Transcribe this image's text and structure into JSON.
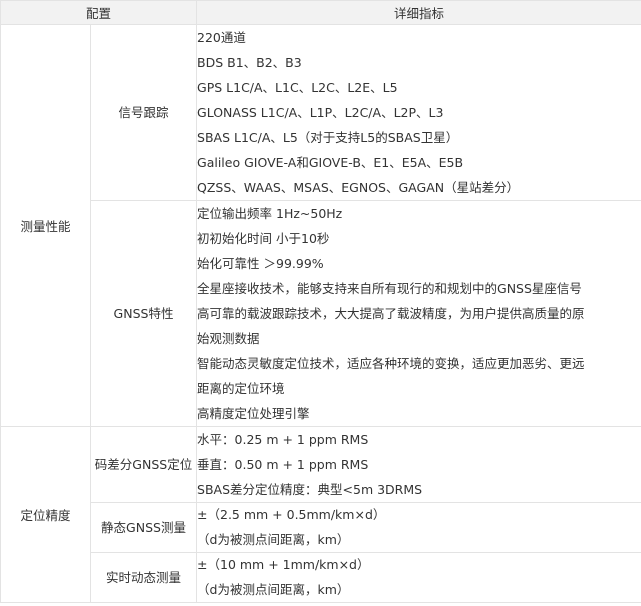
{
  "header": {
    "col1": "配置",
    "col2": "详细指标"
  },
  "sections": [
    {
      "category": "测量性能",
      "groups": [
        {
          "name": "信号跟踪",
          "lines": [
            "220通道",
            "BDS B1、B2、B3",
            "GPS L1C/A、L1C、L2C、L2E、L5",
            "GLONASS L1C/A、L1P、L2C/A、L2P、L3",
            "SBAS L1C/A、L5（对于支持L5的SBAS卫星）",
            "Galileo GIOVE-A和GIOVE-B、E1、E5A、E5B",
            "QZSS、WAAS、MSAS、EGNOS、GAGAN（星站差分）"
          ]
        },
        {
          "name": "GNSS特性",
          "lines": [
            "定位输出频率 1Hz~50Hz",
            "初初始化时间 小于10秒",
            "始化可靠性 ＞99.99%",
            "全星座接收技术，能够支持来自所有现行的和规划中的GNSS星座信号",
            "高可靠的载波跟踪技术，大大提高了载波精度，为用户提供高质量的原",
            "始观测数据",
            "智能动态灵敏度定位技术，适应各种环境的变换，适应更加恶劣、更远",
            "距离的定位环境",
            "高精度定位处理引擎"
          ]
        }
      ]
    },
    {
      "category": "定位精度",
      "groups": [
        {
          "name": "码差分GNSS定位",
          "lines": [
            "水平：0.25 m + 1 ppm RMS",
            "垂直：0.50 m + 1 ppm RMS",
            "SBAS差分定位精度：典型<5m 3DRMS"
          ]
        },
        {
          "name": "静态GNSS测量",
          "lines": [
            "±（2.5 mm + 0.5mm/km×d）",
            "（d为被测点间距离，km）"
          ]
        },
        {
          "name": "实时动态测量",
          "lines": [
            "±（10 mm + 1mm/km×d）",
            "（d为被测点间距离，km）"
          ]
        }
      ]
    }
  ]
}
